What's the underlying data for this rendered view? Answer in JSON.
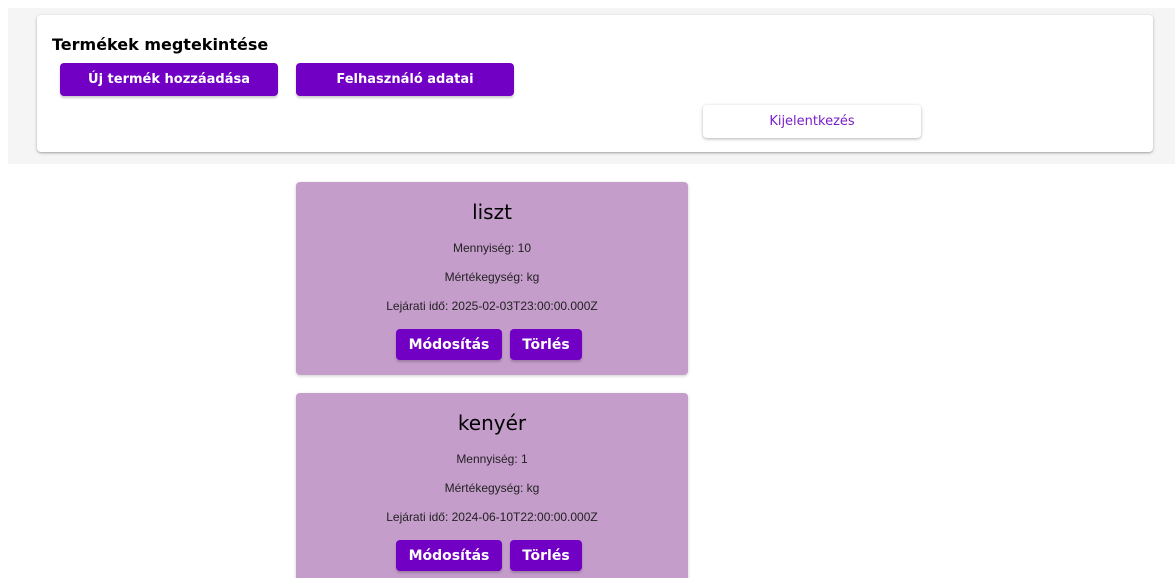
{
  "header": {
    "title": "Termékek megtekintése",
    "add_product_label": "Új termék hozzáadása",
    "user_data_label": "Felhasználó adatai",
    "logout_label": "Kijelentkezés"
  },
  "products": [
    {
      "name": "liszt",
      "quantity": "Mennyiség: 10",
      "unit": "Mértékegység: kg",
      "expiry": "Lejárati idő: 2025-02-03T23:00:00.000Z",
      "edit_label": "Módosítás",
      "delete_label": "Törlés"
    },
    {
      "name": "kenyér",
      "quantity": "Mennyiség: 1",
      "unit": "Mértékegység: kg",
      "expiry": "Lejárati idő: 2024-06-10T22:00:00.000Z",
      "edit_label": "Módosítás",
      "delete_label": "Törlés"
    }
  ],
  "colors": {
    "primary": "#7200c4",
    "card_background": "#c59dcb",
    "logout_text": "#7a1fc7",
    "header_band": "#f5f5f5"
  }
}
